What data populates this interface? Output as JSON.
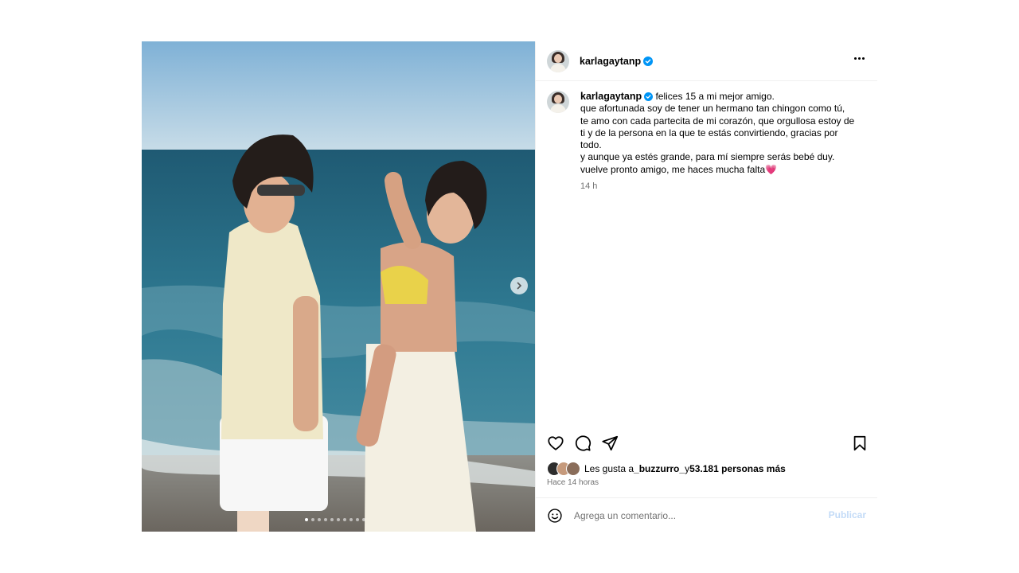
{
  "post": {
    "author": "karlagaytanp",
    "caption_lines": [
      "felices 15 a mi mejor amigo.",
      "que afortunada soy de tener un hermano tan chingon como tú,",
      "te amo con cada partecita de mi corazón, que orgullosa estoy de",
      "ti y de la persona en la que te estás convirtiendo, gracias por",
      "todo.",
      "y aunque ya estés grande, para mí siempre serás bebé duy.",
      "vuelve pronto amigo, me haces mucha falta💗"
    ],
    "caption_time": "14 h",
    "likes_prefix": "Les gusta a ",
    "likes_user": "_buzzurro_",
    "likes_middle": " y ",
    "likes_count": "53.181 personas más",
    "posted_at": "Hace 14 horas",
    "comment_placeholder": "Agrega un comentario...",
    "publish_label": "Publicar",
    "carousel_total": 10,
    "carousel_active": 1
  },
  "colors": {
    "verified": "#0095f6",
    "muted_text": "#737373",
    "publish_disabled": "#c3dbf7",
    "divider": "#efefef"
  },
  "icons": {
    "verified": "verified-badge-icon",
    "more": "more-options-icon",
    "like": "heart-icon",
    "comment": "comment-bubble-icon",
    "share": "paper-plane-icon",
    "save": "bookmark-icon",
    "emoji": "smiley-icon",
    "next": "chevron-right-icon"
  }
}
